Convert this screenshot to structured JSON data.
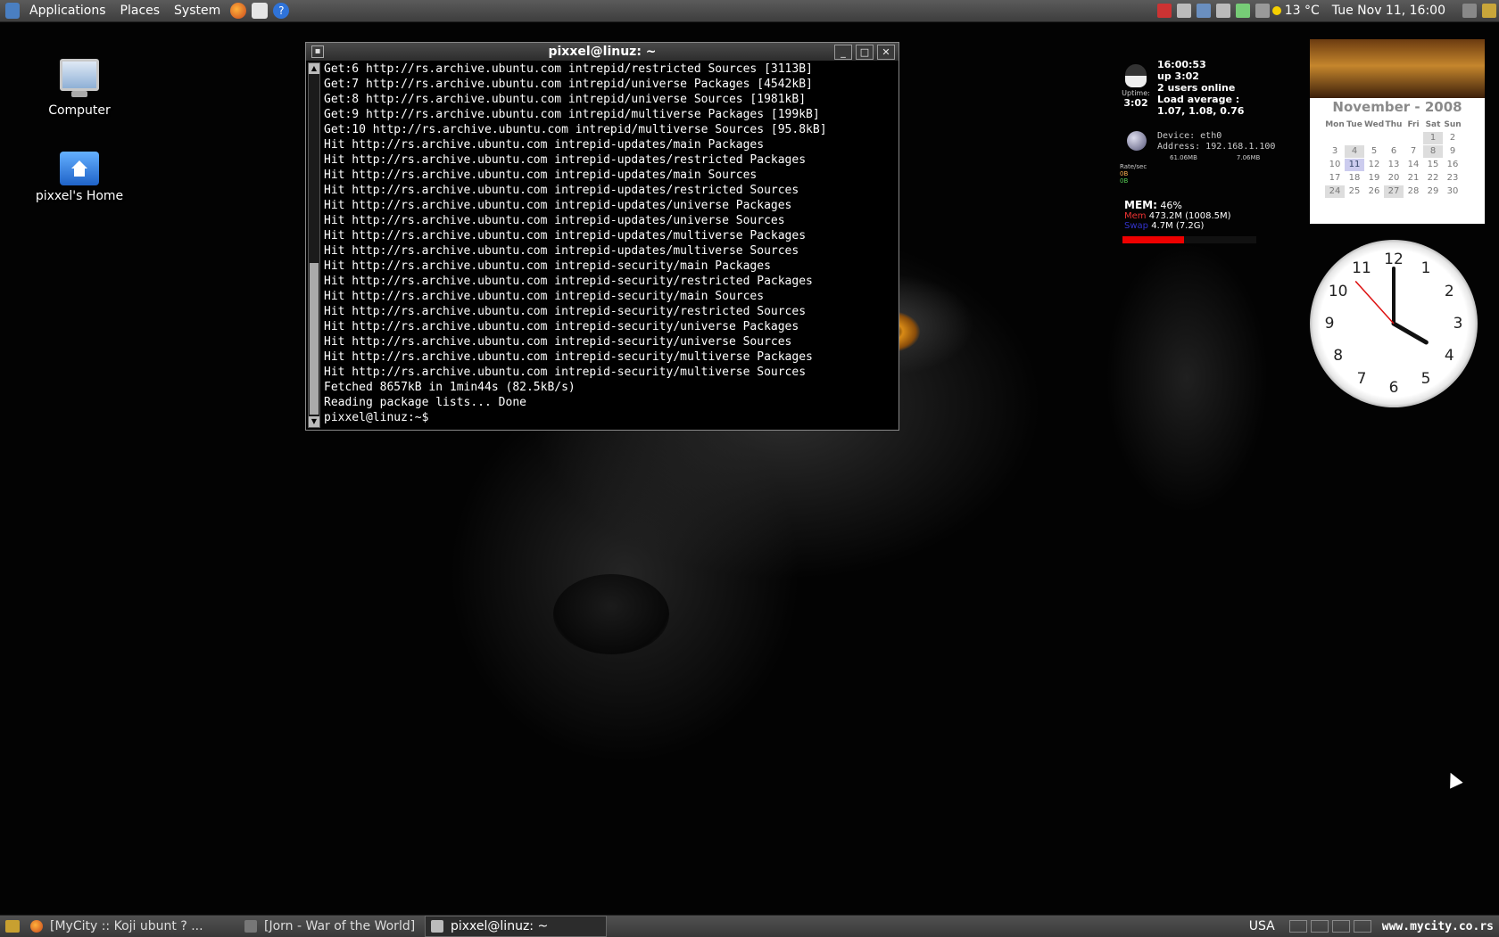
{
  "top_panel": {
    "menus": [
      "Applications",
      "Places",
      "System"
    ],
    "launchers": [
      "firefox-icon",
      "mail-icon",
      "help-icon"
    ],
    "weather": "13 °C",
    "clock": "Tue Nov 11, 16:00"
  },
  "desktop_icons": [
    {
      "label": "Computer",
      "icon": "computer-icon"
    },
    {
      "label": "pixxel's Home",
      "icon": "home-folder-icon"
    }
  ],
  "terminal": {
    "title": "pixxel@linuz: ~",
    "lines": [
      "Get:6 http://rs.archive.ubuntu.com intrepid/restricted Sources [3113B]",
      "Get:7 http://rs.archive.ubuntu.com intrepid/universe Packages [4542kB]",
      "Get:8 http://rs.archive.ubuntu.com intrepid/universe Sources [1981kB]",
      "Get:9 http://rs.archive.ubuntu.com intrepid/multiverse Packages [199kB]",
      "Get:10 http://rs.archive.ubuntu.com intrepid/multiverse Sources [95.8kB]",
      "Hit http://rs.archive.ubuntu.com intrepid-updates/main Packages",
      "Hit http://rs.archive.ubuntu.com intrepid-updates/restricted Packages",
      "Hit http://rs.archive.ubuntu.com intrepid-updates/main Sources",
      "Hit http://rs.archive.ubuntu.com intrepid-updates/restricted Sources",
      "Hit http://rs.archive.ubuntu.com intrepid-updates/universe Packages",
      "Hit http://rs.archive.ubuntu.com intrepid-updates/universe Sources",
      "Hit http://rs.archive.ubuntu.com intrepid-updates/multiverse Packages",
      "Hit http://rs.archive.ubuntu.com intrepid-updates/multiverse Sources",
      "Hit http://rs.archive.ubuntu.com intrepid-security/main Packages",
      "Hit http://rs.archive.ubuntu.com intrepid-security/restricted Packages",
      "Hit http://rs.archive.ubuntu.com intrepid-security/main Sources",
      "Hit http://rs.archive.ubuntu.com intrepid-security/restricted Sources",
      "Hit http://rs.archive.ubuntu.com intrepid-security/universe Packages",
      "Hit http://rs.archive.ubuntu.com intrepid-security/universe Sources",
      "Hit http://rs.archive.ubuntu.com intrepid-security/multiverse Packages",
      "Hit http://rs.archive.ubuntu.com intrepid-security/multiverse Sources",
      "Fetched 8657kB in 1min44s (82.5kB/s)",
      "Reading package lists... Done",
      "pixxel@linuz:~$"
    ]
  },
  "sysmon": {
    "time": "16:00:53",
    "uptime": "up 3:02",
    "users": "2 users online",
    "load_label": "Load average :",
    "load_values": "1.07, 1.08, 0.76",
    "uptime_label": "Uptime:",
    "uptime_short": "3:02",
    "net_device": "Device: eth0",
    "net_address": "Address: 192.168.1.100",
    "net_down_total": "61.06MB",
    "net_up_total": "7.06MB",
    "rate_label": "Rate/sec",
    "rate_down": "0B",
    "rate_up": "0B",
    "mem_label": "MEM:",
    "mem_percent": "46%",
    "mem_line": "473.2M (1008.5M)",
    "mem_line_label": "Mem",
    "swap_line": "4.7M (7.2G)",
    "swap_line_label": "Swap",
    "mem_fraction": 0.46
  },
  "calendar": {
    "title": "November - 2008",
    "weekdays": [
      "Mon",
      "Tue",
      "Wed",
      "Thu",
      "Fri",
      "Sat",
      "Sun"
    ],
    "weeks": [
      [
        "",
        "",
        "",
        "",
        "",
        "1",
        "2"
      ],
      [
        "3",
        "4",
        "5",
        "6",
        "7",
        "8",
        "9"
      ],
      [
        "10",
        "11",
        "12",
        "13",
        "14",
        "15",
        "16"
      ],
      [
        "17",
        "18",
        "19",
        "20",
        "21",
        "22",
        "23"
      ],
      [
        "24",
        "25",
        "26",
        "27",
        "28",
        "29",
        "30"
      ]
    ],
    "today": "11",
    "marked": [
      "1",
      "4",
      "8",
      "24",
      "27"
    ]
  },
  "clock_widget": {
    "numbers": [
      "12",
      "1",
      "2",
      "3",
      "4",
      "5",
      "6",
      "7",
      "8",
      "9",
      "10",
      "11"
    ],
    "hour": 4,
    "minute": 0,
    "second": 53
  },
  "taskbar": {
    "tasks": [
      {
        "label": "[MyCity :: Koji ubunt ? ...",
        "icon": "firefox-icon",
        "active": false
      },
      {
        "label": "[Jorn - War of the World]",
        "icon": "music-player-icon",
        "active": false
      },
      {
        "label": "pixxel@linuz: ~",
        "icon": "terminal-icon",
        "active": true
      }
    ],
    "keyboard_layout": "USA",
    "watermark": "www.mycity.co.rs"
  }
}
